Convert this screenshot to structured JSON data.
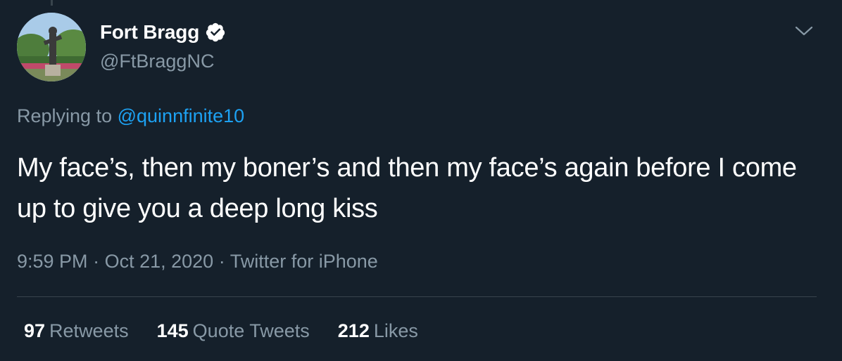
{
  "author": {
    "display_name": "Fort Bragg",
    "handle": "@FtBraggNC",
    "verified_icon": "verified-badge-icon"
  },
  "reply": {
    "prefix": "Replying to",
    "mention": "@quinnfinite10"
  },
  "tweet": {
    "text": "My face’s, then my boner’s and then my face’s again before I come up to give you a deep long kiss"
  },
  "meta": {
    "time": "9:59 PM",
    "separator1": "·",
    "date": "Oct 21, 2020",
    "separator2": "·",
    "source": "Twitter for iPhone"
  },
  "stats": {
    "retweets_count": "97",
    "retweets_label": "Retweets",
    "quotes_count": "145",
    "quotes_label": "Quote Tweets",
    "likes_count": "212",
    "likes_label": "Likes"
  },
  "colors": {
    "background": "#15202b",
    "text_primary": "#ffffff",
    "text_secondary": "#8899a6",
    "link": "#1da1f2",
    "divider": "#38444d"
  }
}
